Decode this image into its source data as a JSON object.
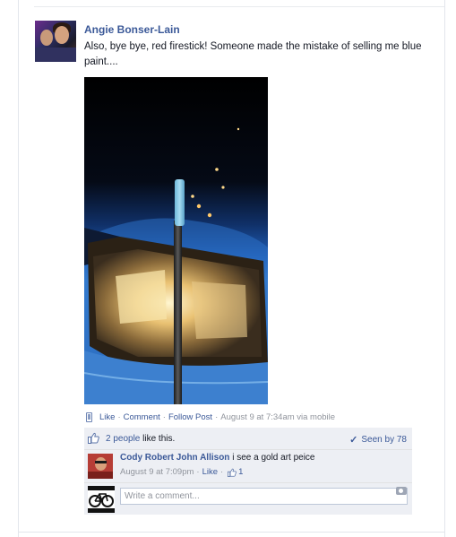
{
  "post": {
    "author": "Angie Bonser-Lain",
    "text": "Also, bye bye, red firestick! Someone made the mistake of selling me blue paint....",
    "actions": {
      "like": "Like",
      "comment": "Comment",
      "follow": "Follow Post",
      "timestamp": "August 9 at 7:34am via mobile"
    }
  },
  "ufi": {
    "likes_count": "2 people",
    "likes_suffix": " like this.",
    "seen": "Seen by 78",
    "comment": {
      "author": "Cody Robert John Allison",
      "text": " i see a gold art peice",
      "timestamp": "August 9 at 7:09pm",
      "like": "Like",
      "like_count": "1"
    },
    "write_placeholder": "Write a comment..."
  },
  "colors": {
    "link": "#3b5998",
    "muted": "#90949c",
    "ufi_bg": "#edeff4"
  },
  "icons": [
    "mobile-phone-icon",
    "thumbs-up-icon",
    "check-icon",
    "camera-icon"
  ]
}
